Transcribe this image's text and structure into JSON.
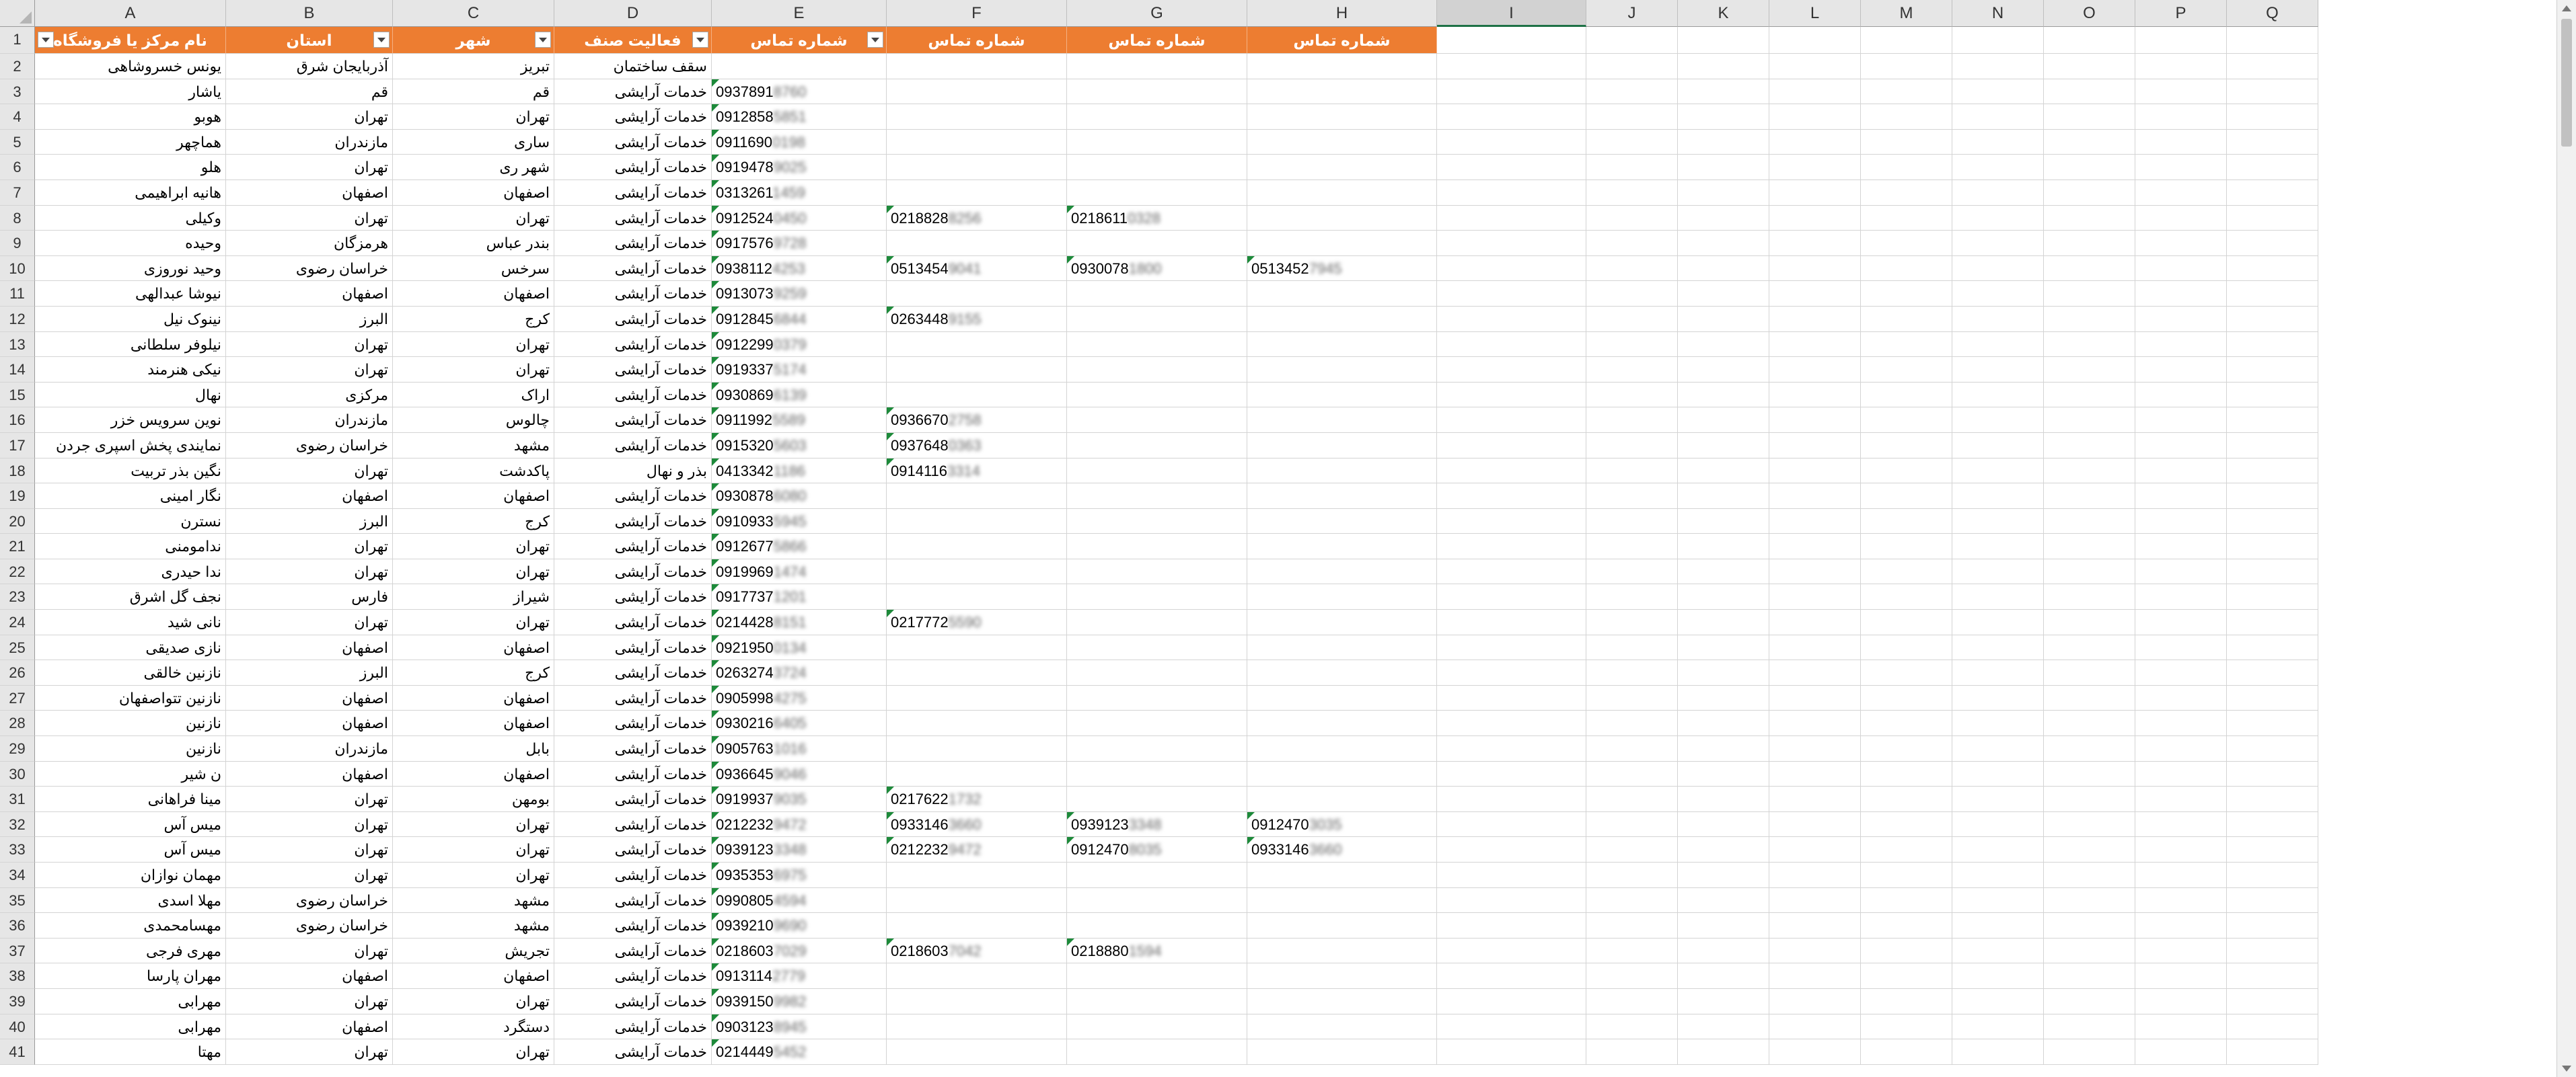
{
  "sheet": {
    "columns": [
      "A",
      "B",
      "C",
      "D",
      "E",
      "F",
      "G",
      "H",
      "I",
      "J",
      "K",
      "L",
      "M",
      "N",
      "O",
      "P",
      "Q"
    ],
    "selected_column": "I",
    "header_row": [
      "نام مرکز یا فروشگاه",
      "استان",
      "شهر",
      "فعالیت صنف",
      "شماره تماس",
      "شماره تماس",
      "شماره تماس",
      "شماره تماس"
    ],
    "rows": [
      {
        "n": "2",
        "a": "یونس خسروشاهی",
        "b": "آذربایجان شرق",
        "c": "تبریز",
        "d": "سقف ساختمان",
        "e": "",
        "f": "",
        "g": "",
        "h": ""
      },
      {
        "n": "3",
        "a": "یاشار",
        "b": "قم",
        "c": "قم",
        "d": "خدمات آرایشی",
        "e": "0937891",
        "et": "8760",
        "f": "",
        "g": "",
        "h": ""
      },
      {
        "n": "4",
        "a": "هوبو",
        "b": "تهران",
        "c": "تهران",
        "d": "خدمات آرایشی",
        "e": "0912858",
        "et": "5851",
        "f": "",
        "g": "",
        "h": ""
      },
      {
        "n": "5",
        "a": "هماچهر",
        "b": "مازندران",
        "c": "ساری",
        "d": "خدمات آرایشی",
        "e": "0911690",
        "et": "0198",
        "f": "",
        "g": "",
        "h": ""
      },
      {
        "n": "6",
        "a": "هلو",
        "b": "تهران",
        "c": "شهر ری",
        "d": "خدمات آرایشی",
        "e": "0919478",
        "et": "9025",
        "f": "",
        "g": "",
        "h": ""
      },
      {
        "n": "7",
        "a": "هانیه ابراهیمی",
        "b": "اصفهان",
        "c": "اصفهان",
        "d": "خدمات آرایشی",
        "e": "0313261",
        "et": "1459",
        "f": "",
        "g": "",
        "h": ""
      },
      {
        "n": "8",
        "a": "وکیلی",
        "b": "تهران",
        "c": "تهران",
        "d": "خدمات آرایشی",
        "e": "0912524",
        "et": "0450",
        "f": "0218828",
        "ft": "8256",
        "g": "0218611",
        "gt": "0328",
        "h": ""
      },
      {
        "n": "9",
        "a": "وحیده",
        "b": "هرمزگان",
        "c": "بندر عباس",
        "d": "خدمات آرایشی",
        "e": "0917576",
        "et": "9728",
        "f": "",
        "g": "",
        "h": ""
      },
      {
        "n": "10",
        "a": "وحید نوروزی",
        "b": "خراسان رضوی",
        "c": "سرخس",
        "d": "خدمات آرایشی",
        "e": "0938112",
        "et": "4253",
        "f": "0513454",
        "ft": "9041",
        "g": "0930078",
        "gt": "1800",
        "h": "0513452",
        "ht": "7945"
      },
      {
        "n": "11",
        "a": "نیوشا عبدالهی",
        "b": "اصفهان",
        "c": "اصفهان",
        "d": "خدمات آرایشی",
        "e": "0913073",
        "et": "9259",
        "f": "",
        "g": "",
        "h": ""
      },
      {
        "n": "12",
        "a": "نینوک نیل",
        "b": "البرز",
        "c": "کرج",
        "d": "خدمات آرایشی",
        "e": "0912845",
        "et": "6844",
        "f": "0263448",
        "ft": "9155",
        "g": "",
        "h": ""
      },
      {
        "n": "13",
        "a": "نیلوفر سلطانی",
        "b": "تهران",
        "c": "تهران",
        "d": "خدمات آرایشی",
        "e": "0912299",
        "et": "0379",
        "f": "",
        "g": "",
        "h": ""
      },
      {
        "n": "14",
        "a": "نیکی هنرمند",
        "b": "تهران",
        "c": "تهران",
        "d": "خدمات آرایشی",
        "e": "0919337",
        "et": "5174",
        "f": "",
        "g": "",
        "h": ""
      },
      {
        "n": "15",
        "a": "نهال",
        "b": "مرکزی",
        "c": "اراک",
        "d": "خدمات آرایشی",
        "e": "0930869",
        "et": "6139",
        "f": "",
        "g": "",
        "h": ""
      },
      {
        "n": "16",
        "a": "نوین سرویس خزر",
        "b": "مازندران",
        "c": "چالوس",
        "d": "خدمات آرایشی",
        "e": "0911992",
        "et": "5589",
        "f": "0936670",
        "ft": "2758",
        "g": "",
        "h": ""
      },
      {
        "n": "17",
        "a": "نمایندی پخش اسپری جردن",
        "b": "خراسان رضوی",
        "c": "مشهد",
        "d": "خدمات آرایشی",
        "e": "0915320",
        "et": "5603",
        "f": "0937648",
        "ft": "0363",
        "g": "",
        "h": ""
      },
      {
        "n": "18",
        "a": "نگین بذر تربیت",
        "b": "تهران",
        "c": "پاکدشت",
        "d": "بذر و نهال",
        "e": "0413342",
        "et": "1186",
        "f": "0914116",
        "ft": "3314",
        "g": "",
        "h": ""
      },
      {
        "n": "19",
        "a": "نگار امینی",
        "b": "اصفهان",
        "c": "اصفهان",
        "d": "خدمات آرایشی",
        "e": "0930878",
        "et": "6080",
        "f": "",
        "g": "",
        "h": ""
      },
      {
        "n": "20",
        "a": "نسترن",
        "b": "البرز",
        "c": "کرج",
        "d": "خدمات آرایشی",
        "e": "0910933",
        "et": "5945",
        "f": "",
        "g": "",
        "h": ""
      },
      {
        "n": "21",
        "a": "ندامومنی",
        "b": "تهران",
        "c": "تهران",
        "d": "خدمات آرایشی",
        "e": "0912677",
        "et": "5866",
        "f": "",
        "g": "",
        "h": ""
      },
      {
        "n": "22",
        "a": "ندا حیدری",
        "b": "تهران",
        "c": "تهران",
        "d": "خدمات آرایشی",
        "e": "0919969",
        "et": "1474",
        "f": "",
        "g": "",
        "h": ""
      },
      {
        "n": "23",
        "a": "نجف گل اشرق",
        "b": "فارس",
        "c": "شیراز",
        "d": "خدمات آرایشی",
        "e": "0917737",
        "et": "1201",
        "f": "",
        "g": "",
        "h": ""
      },
      {
        "n": "24",
        "a": "نانی شید",
        "b": "تهران",
        "c": "تهران",
        "d": "خدمات آرایشی",
        "e": "0214428",
        "et": "8151",
        "f": "0217772",
        "ft": "5590",
        "g": "",
        "h": ""
      },
      {
        "n": "25",
        "a": "نازی صدیقی",
        "b": "اصفهان",
        "c": "اصفهان",
        "d": "خدمات آرایشی",
        "e": "0921950",
        "et": "0134",
        "f": "",
        "g": "",
        "h": ""
      },
      {
        "n": "26",
        "a": "نازنین خالقی",
        "b": "البرز",
        "c": "کرج",
        "d": "خدمات آرایشی",
        "e": "0263274",
        "et": "3724",
        "f": "",
        "g": "",
        "h": ""
      },
      {
        "n": "27",
        "a": "نازنین تتواصفهان",
        "b": "اصفهان",
        "c": "اصفهان",
        "d": "خدمات آرایشی",
        "e": "0905998",
        "et": "4275",
        "f": "",
        "g": "",
        "h": ""
      },
      {
        "n": "28",
        "a": "نازنین",
        "b": "اصفهان",
        "c": "اصفهان",
        "d": "خدمات آرایشی",
        "e": "0930216",
        "et": "6405",
        "f": "",
        "g": "",
        "h": ""
      },
      {
        "n": "29",
        "a": "نازنین",
        "b": "مازندران",
        "c": "بابل",
        "d": "خدمات آرایشی",
        "e": "0905763",
        "et": "1016",
        "f": "",
        "g": "",
        "h": ""
      },
      {
        "n": "30",
        "a": "ن شیر",
        "b": "اصفهان",
        "c": "اصفهان",
        "d": "خدمات آرایشی",
        "e": "0936645",
        "et": "9046",
        "f": "",
        "g": "",
        "h": ""
      },
      {
        "n": "31",
        "a": "مینا فراهانی",
        "b": "تهران",
        "c": "بومهن",
        "d": "خدمات آرایشی",
        "e": "0919937",
        "et": "9035",
        "f": "0217622",
        "ft": "1732",
        "g": "",
        "h": ""
      },
      {
        "n": "32",
        "a": "میس آس",
        "b": "تهران",
        "c": "تهران",
        "d": "خدمات آرایشی",
        "e": "0212232",
        "et": "9472",
        "f": "0933146",
        "ft": "3660",
        "g": "0939123",
        "gt": "3348",
        "h": "0912470",
        "ht": "3035"
      },
      {
        "n": "33",
        "a": "میس آس",
        "b": "تهران",
        "c": "تهران",
        "d": "خدمات آرایشی",
        "e": "0939123",
        "et": "3348",
        "f": "0212232",
        "ft": "9472",
        "g": "0912470",
        "gt": "8035",
        "h": "0933146",
        "ht": "3660"
      },
      {
        "n": "34",
        "a": "مهمان نوازان",
        "b": "تهران",
        "c": "تهران",
        "d": "خدمات آرایشی",
        "e": "0935353",
        "et": "6975",
        "f": "",
        "g": "",
        "h": ""
      },
      {
        "n": "35",
        "a": "مهلا اسدی",
        "b": "خراسان رضوی",
        "c": "مشهد",
        "d": "خدمات آرایشی",
        "e": "0990805",
        "et": "4594",
        "f": "",
        "g": "",
        "h": ""
      },
      {
        "n": "36",
        "a": "مهسامحمدی",
        "b": "خراسان رضوی",
        "c": "مشهد",
        "d": "خدمات آرایشی",
        "e": "0939210",
        "et": "9690",
        "f": "",
        "g": "",
        "h": ""
      },
      {
        "n": "37",
        "a": "مهری فرجی",
        "b": "تهران",
        "c": "تجریش",
        "d": "خدمات آرایشی",
        "e": "0218603",
        "et": "7029",
        "f": "0218603",
        "ft": "7042",
        "g": "0218880",
        "gt": "1594",
        "h": ""
      },
      {
        "n": "38",
        "a": "مهران پارسا",
        "b": "اصفهان",
        "c": "اصفهان",
        "d": "خدمات آرایشی",
        "e": "0913114",
        "et": "2779",
        "f": "",
        "g": "",
        "h": ""
      },
      {
        "n": "39",
        "a": "مهرابی",
        "b": "تهران",
        "c": "تهران",
        "d": "خدمات آرایشی",
        "e": "0939150",
        "et": "9982",
        "f": "",
        "g": "",
        "h": ""
      },
      {
        "n": "40",
        "a": "مهرابی",
        "b": "اصفهان",
        "c": "دستگرد",
        "d": "خدمات آرایشی",
        "e": "0903123",
        "et": "8945",
        "f": "",
        "g": "",
        "h": ""
      },
      {
        "n": "41",
        "a": "مهتا",
        "b": "تهران",
        "c": "تهران",
        "d": "خدمات آرایشی",
        "e": "0214449",
        "et": "5452",
        "f": "",
        "g": "",
        "h": ""
      }
    ]
  },
  "colors": {
    "header_fill": "#ed7d31",
    "header_text": "#ffffff",
    "grid": "#d4d4d4",
    "comment_triangle": "#1d8a3a",
    "selection": "#1e7145"
  }
}
